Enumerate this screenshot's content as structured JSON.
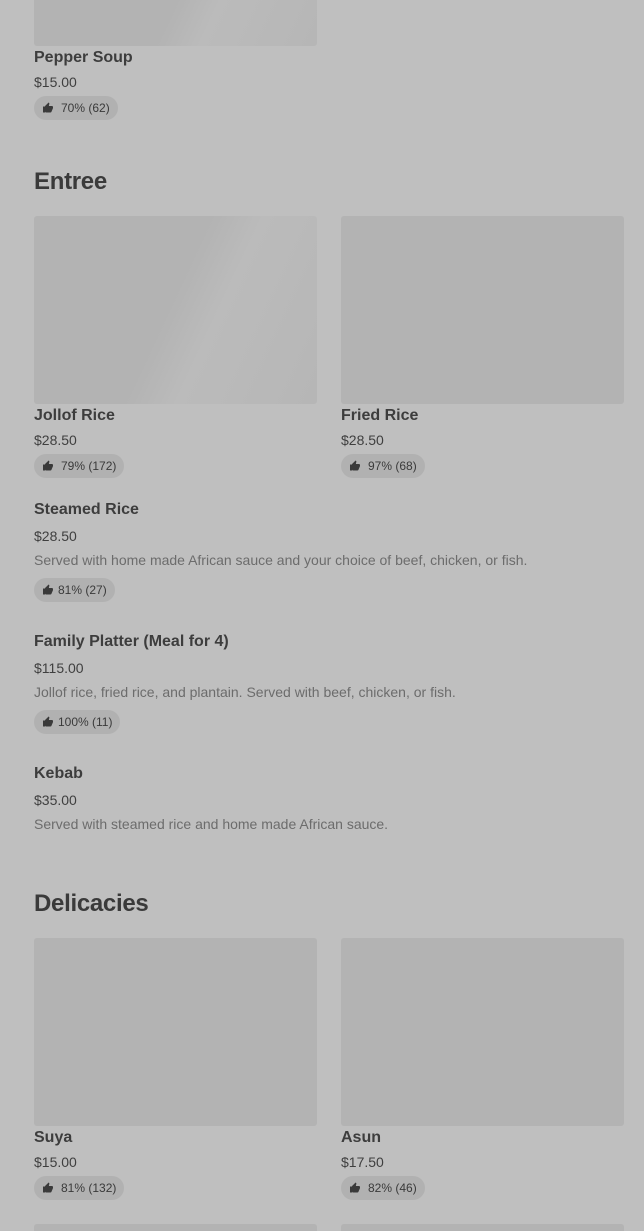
{
  "top_item": {
    "name": "Pepper Soup",
    "price": "$15.00",
    "rating": "70% (62)"
  },
  "sections": [
    {
      "title": "Entree",
      "cards": [
        {
          "name": "Jollof Rice",
          "price": "$28.50",
          "rating": "79% (172)"
        },
        {
          "name": "Fried Rice",
          "price": "$28.50",
          "rating": "97% (68)"
        }
      ],
      "list_items": [
        {
          "name": "Steamed Rice",
          "price": "$28.50",
          "description": "Served with home made African sauce and your choice of beef, chicken, or fish.",
          "rating": "81% (27)"
        },
        {
          "name": "Family Platter (Meal for 4)",
          "price": "$115.00",
          "description": "Jollof rice, fried rice, and plantain. Served with beef, chicken, or fish.",
          "rating": "100% (11)"
        },
        {
          "name": "Kebab",
          "price": "$35.00",
          "description": "Served with steamed rice and home made African sauce.",
          "rating": ""
        }
      ]
    },
    {
      "title": "Delicacies",
      "cards": [
        {
          "name": "Suya",
          "price": "$15.00",
          "rating": "81% (132)"
        },
        {
          "name": "Asun",
          "price": "$17.50",
          "rating": "82% (46)"
        }
      ]
    }
  ],
  "icons": {
    "rating": "thumbs-up-icon"
  },
  "colors": {
    "background": "#bfbfbf",
    "image_placeholder": "#b3b3b3",
    "rating_pill": "#b1b1b1",
    "text": "#3a3a3a",
    "description": "#6c6c6c"
  }
}
